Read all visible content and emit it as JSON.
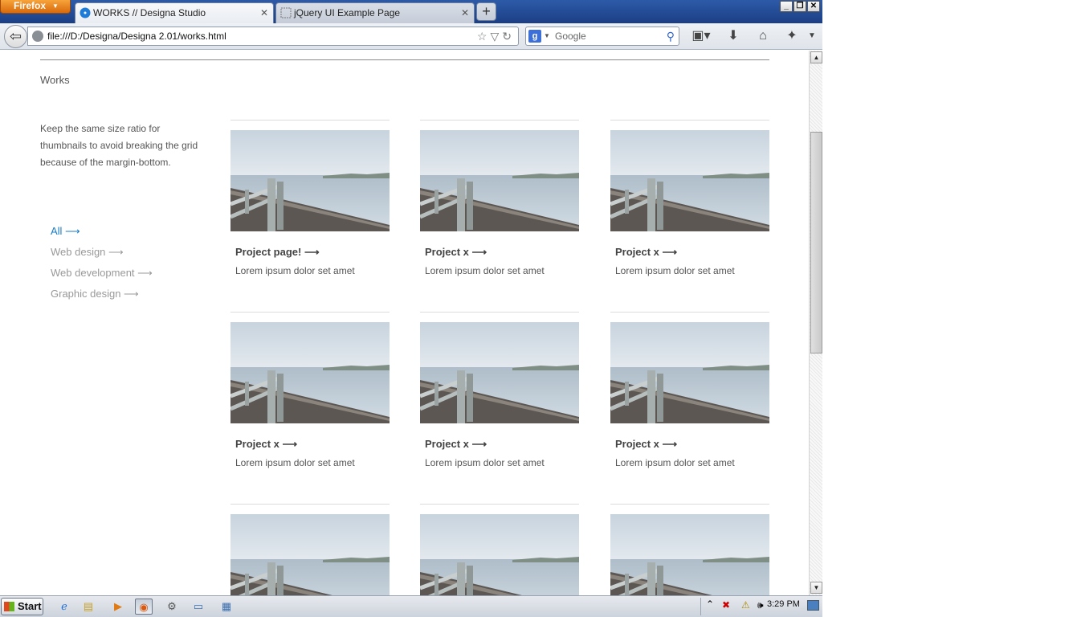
{
  "browser": {
    "app_button": "Firefox",
    "tabs": [
      {
        "title": "WORKS // Designa Studio",
        "active": true
      },
      {
        "title": "jQuery UI Example Page",
        "active": false
      }
    ],
    "new_tab_label": "+",
    "url": "file:///D:/Designa/Designa 2.01/works.html",
    "search_placeholder": "Google",
    "window_controls": [
      "minimize-icon",
      "restore-icon",
      "close-icon"
    ],
    "toolbar_icons": [
      "bookmarks-icon",
      "download-icon",
      "home-icon",
      "addons-icon",
      "menu-icon"
    ]
  },
  "page": {
    "heading": "Works",
    "intro": "Keep the same size ratio for thumbnails to avoid breaking the grid because of the margin-bottom.",
    "filters": [
      {
        "label": "All ⟶",
        "active": true
      },
      {
        "label": "Web design ⟶",
        "active": false
      },
      {
        "label": "Web development ⟶",
        "active": false
      },
      {
        "label": "Graphic design ⟶",
        "active": false
      }
    ],
    "projects": [
      {
        "title": "Project page! ⟶",
        "desc": "Lorem ipsum dolor set amet"
      },
      {
        "title": "Project x ⟶",
        "desc": "Lorem ipsum dolor set amet"
      },
      {
        "title": "Project x ⟶",
        "desc": "Lorem ipsum dolor set amet"
      },
      {
        "title": "Project x ⟶",
        "desc": "Lorem ipsum dolor set amet"
      },
      {
        "title": "Project x ⟶",
        "desc": "Lorem ipsum dolor set amet"
      },
      {
        "title": "Project x ⟶",
        "desc": "Lorem ipsum dolor set amet"
      },
      {
        "title": "",
        "desc": ""
      },
      {
        "title": "",
        "desc": ""
      },
      {
        "title": "",
        "desc": ""
      }
    ]
  },
  "taskbar": {
    "start_label": "Start",
    "clock": "3:29 PM",
    "apps": [
      "ie-icon",
      "explorer-icon",
      "media-player-icon",
      "firefox-icon",
      "settings-icon",
      "window-icon",
      "notepad-icon"
    ]
  },
  "colors": {
    "accent": "#1a7bc4",
    "muted_text": "#999999",
    "body_text": "#555555"
  }
}
